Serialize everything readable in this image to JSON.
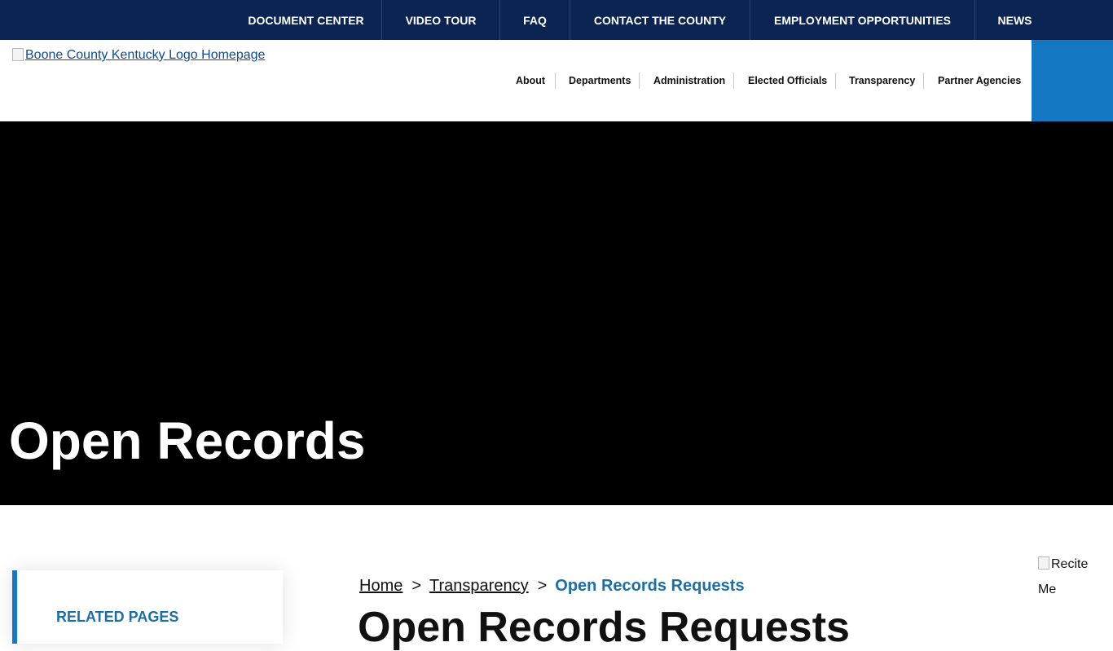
{
  "topbar": {
    "items": [
      {
        "label": "DOCUMENT CENTER"
      },
      {
        "label": "VIDEO TOUR"
      },
      {
        "label": "FAQ"
      },
      {
        "label": "CONTACT THE COUNTY"
      },
      {
        "label": "EMPLOYMENT OPPORTUNITIES"
      },
      {
        "label": "NEWS"
      }
    ]
  },
  "header": {
    "logo_alt": "Boone County Kentucky Logo Homepage",
    "nav": [
      {
        "label": "About"
      },
      {
        "label": "Departments"
      },
      {
        "label": "Administration"
      },
      {
        "label": "Elected Officials"
      },
      {
        "label": "Transparency"
      },
      {
        "label": "Partner Agencies"
      }
    ]
  },
  "hero": {
    "title": "Open Records"
  },
  "sidebar": {
    "heading": "RELATED PAGES"
  },
  "breadcrumb": {
    "home": "Home",
    "separator": ">",
    "parent": "Transparency",
    "current": "Open Records Requests"
  },
  "main": {
    "heading": "Open Records Requests"
  },
  "recite": {
    "line1": "Recite",
    "line2": "Me"
  },
  "colors": {
    "topbar_bg": "#0b2451",
    "accent_blue": "#1578c2",
    "link_blue": "#1b6fa8",
    "hero_bg": "#000000"
  }
}
